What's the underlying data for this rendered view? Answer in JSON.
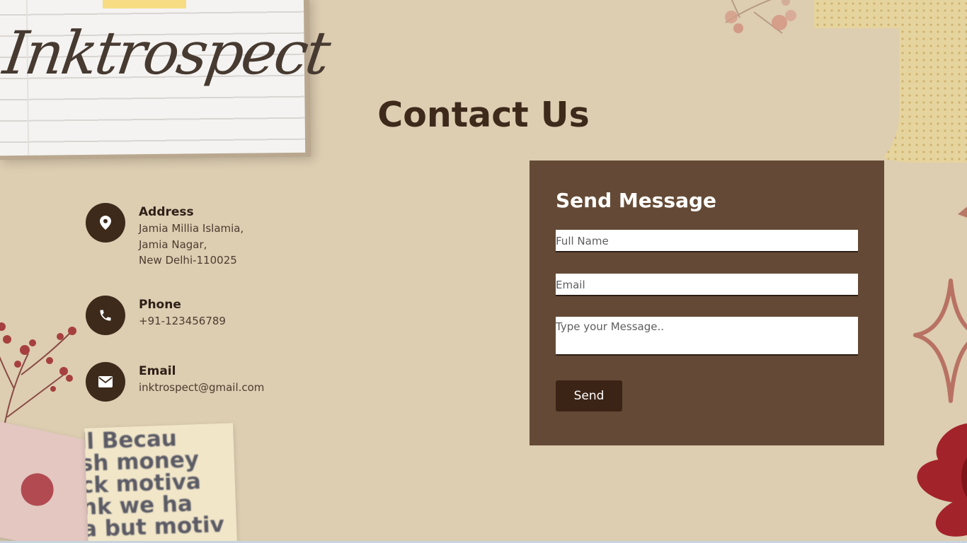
{
  "brand": {
    "logo_text": "Inktrospect"
  },
  "page": {
    "title": "Contact Us"
  },
  "contact_info": {
    "address": {
      "title": "Address",
      "lines": [
        "Jamia Millia Islamia,",
        "Jamia Nagar,",
        "New Delhi-110025"
      ],
      "icon": "location-pin-icon"
    },
    "phone": {
      "title": "Phone",
      "value": "+91-123456789",
      "icon": "phone-icon"
    },
    "email": {
      "title": "Email",
      "value": "inktrospect@gmail.com",
      "icon": "envelope-icon"
    }
  },
  "form": {
    "title": "Send Message",
    "full_name_placeholder": "Full Name",
    "email_placeholder": "Email",
    "message_placeholder": "Type your Message..",
    "send_label": "Send"
  },
  "decor": {
    "clipping_text": "ll Becau\nsh money\nck motiva\nnk we ha\na but motiv"
  },
  "colors": {
    "background": "#ddcdb1",
    "panel": "#644a36",
    "dark_brown": "#3d2a1b",
    "button": "#3b2416"
  }
}
